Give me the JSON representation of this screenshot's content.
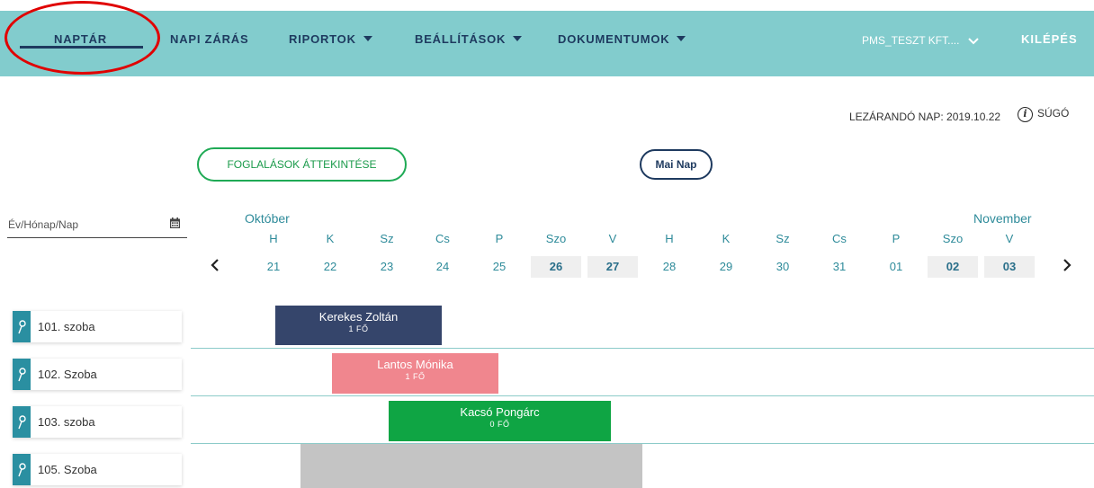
{
  "nav": {
    "items": [
      {
        "label": "NAPTÁR",
        "has_dropdown": false,
        "active": true
      },
      {
        "label": "NAPI ZÁRÁS",
        "has_dropdown": false
      },
      {
        "label": "RIPORTOK",
        "has_dropdown": true
      },
      {
        "label": "BEÁLLÍTÁSOK",
        "has_dropdown": true
      },
      {
        "label": "DOKUMENTUMOK",
        "has_dropdown": true
      }
    ],
    "company": "PMS_TESZT KFT....",
    "logout": "KILÉPÉS",
    "bg_color": "#82cccd",
    "text_color": "#1e3a5f",
    "highlight_color": "#e00000"
  },
  "header": {
    "closing_day": "LEZÁRANDÓ NAP: 2019.10.22",
    "help": "SÚGÓ"
  },
  "buttons": {
    "overview": "FOGLALÁSOK ÁTTEKINTÉSE",
    "today": "Mai Nap"
  },
  "date_input": {
    "placeholder": "Év/Hónap/Nap"
  },
  "calendar": {
    "months": [
      "Október",
      "November"
    ],
    "days": [
      {
        "name": "H",
        "num": "21",
        "weekend": false
      },
      {
        "name": "K",
        "num": "22",
        "weekend": false
      },
      {
        "name": "Sz",
        "num": "23",
        "weekend": false
      },
      {
        "name": "Cs",
        "num": "24",
        "weekend": false
      },
      {
        "name": "P",
        "num": "25",
        "weekend": false
      },
      {
        "name": "Szo",
        "num": "26",
        "weekend": true
      },
      {
        "name": "V",
        "num": "27",
        "weekend": true
      },
      {
        "name": "H",
        "num": "28",
        "weekend": false
      },
      {
        "name": "K",
        "num": "29",
        "weekend": false
      },
      {
        "name": "Sz",
        "num": "30",
        "weekend": false
      },
      {
        "name": "Cs",
        "num": "31",
        "weekend": false
      },
      {
        "name": "P",
        "num": "01",
        "weekend": false
      },
      {
        "name": "Szo",
        "num": "02",
        "weekend": true
      },
      {
        "name": "V",
        "num": "03",
        "weekend": true
      }
    ]
  },
  "rooms": [
    {
      "name": "101. szoba"
    },
    {
      "name": "102. Szoba"
    },
    {
      "name": "103. szoba"
    },
    {
      "name": "105. Szoba"
    }
  ],
  "bookings": [
    {
      "guest": "Kerekes Zoltán",
      "persons": "1 FŐ",
      "color": "#35456b"
    },
    {
      "guest": "Lantos Mónika",
      "persons": "1 FŐ",
      "color": "#f0868e"
    },
    {
      "guest": "Kacsó Pongárc",
      "persons": "0 FŐ",
      "color": "#0fa544"
    }
  ]
}
